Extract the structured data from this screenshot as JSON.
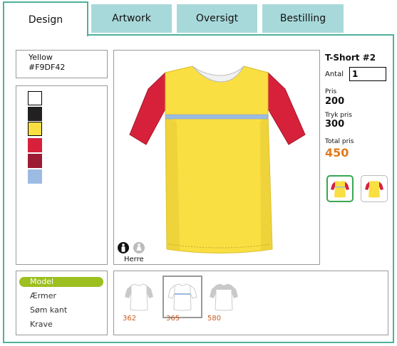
{
  "tabs": [
    {
      "label": "Design"
    },
    {
      "label": "Artwork"
    },
    {
      "label": "Oversigt"
    },
    {
      "label": "Bestilling"
    }
  ],
  "color_info": {
    "name": "Yellow",
    "hex": "#F9DF42"
  },
  "swatches": [
    "#ffffff",
    "#222021",
    "#f9df42",
    "#d7213b",
    "#9b1c34",
    "#9bbbe2"
  ],
  "selected_swatch_index": 2,
  "preview": {
    "gender_label": "Herre"
  },
  "product": {
    "title": "T-Short #2",
    "quantity_label": "Antal",
    "quantity_value": "1",
    "price_label": "Pris",
    "price_value": "200",
    "print_price_label": "Tryk pris",
    "print_price_value": "300",
    "total_label": "Total pris",
    "total_value": "450"
  },
  "menu": [
    {
      "label": "Model"
    },
    {
      "label": "Ærmer"
    },
    {
      "label": "Søm kant"
    },
    {
      "label": "Krave"
    }
  ],
  "models": [
    {
      "code": "362"
    },
    {
      "code": "365"
    },
    {
      "code": "580"
    }
  ],
  "colors": {
    "accent": "#4fb09c",
    "tab_bg": "#a8d9da",
    "shirt_body": "#f9df42",
    "shirt_sleeve": "#d7213b",
    "stripe": "#9bbbe2",
    "menu_active": "#9dbf1f",
    "total_price": "#e07a1c",
    "model_code": "#c85b1e"
  }
}
